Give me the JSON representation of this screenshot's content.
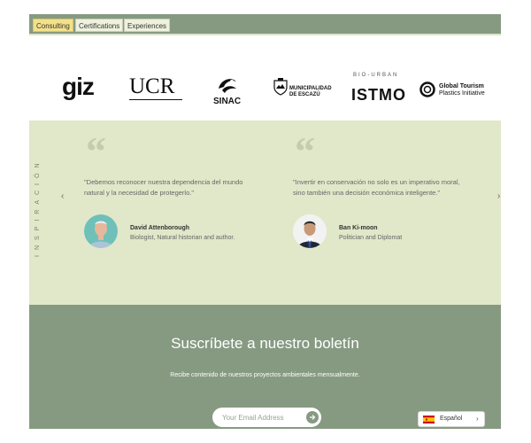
{
  "tabs": [
    "Consulting",
    "Certifications",
    "Experiences"
  ],
  "logos": {
    "giz": "giz",
    "ucr": "UCR",
    "sinac": "SINAC",
    "escazu_line1": "MUNICIPALIDAD",
    "escazu_line2": "DE ESCAZÚ",
    "biourban": "BIO-URBAN",
    "istmo": "ISTMO",
    "gt_line1": "Global Tourism",
    "gt_line2": "Plastics Initiative"
  },
  "inspiration": {
    "label": "INSPIRACIÓN",
    "quotes": [
      {
        "text": "\"Debemos reconocer nuestra dependencia del mundo natural y la necesidad de protegerlo.\"",
        "author": "David Attenborough",
        "role": "Biologist, Natural historian and author."
      },
      {
        "text": "\"Invertir en conservación no solo es un imperativo moral, sino también una decisión económica inteligente.\"",
        "author": "Ban Ki-moon",
        "role": "Politician and Diplomat"
      }
    ]
  },
  "newsletter": {
    "title": "Suscríbete a nuestro boletín",
    "subtitle": "Recibe contenido de nuestros proyectos ambientales mensualmente.",
    "placeholder": "Your Email Address"
  },
  "language": {
    "label": "Español"
  },
  "colors": {
    "green": "#869a82",
    "cream": "#e1e7c9",
    "active_tab": "#f4e089"
  },
  "icons": {
    "arrow_left": "‹",
    "arrow_right": "›",
    "chevron": "›",
    "quote_mark": "“"
  }
}
